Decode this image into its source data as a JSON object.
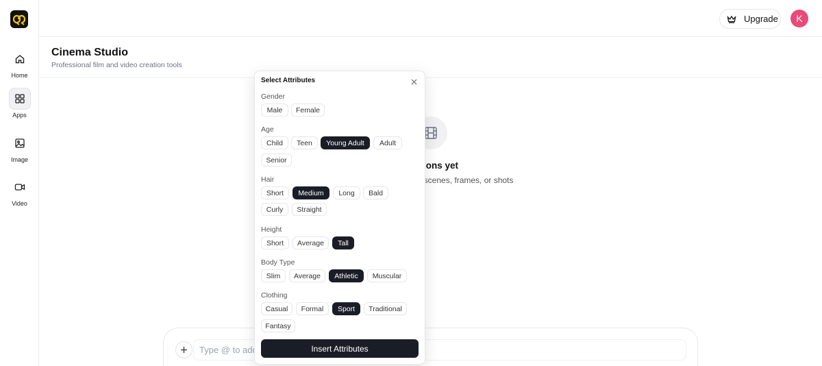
{
  "nav": {
    "items": [
      {
        "label": "Home"
      },
      {
        "label": "Apps"
      },
      {
        "label": "Image"
      },
      {
        "label": "Video"
      }
    ]
  },
  "header": {
    "upgrade_label": "Upgrade",
    "avatar_initial": "K"
  },
  "page": {
    "title": "Cinema Studio",
    "subtitle": "Professional film and video creation tools"
  },
  "empty_state": {
    "title": "ations yet",
    "description": "s, scenes, frames, or shots"
  },
  "composer": {
    "placeholder": "Type @ to add a"
  },
  "attributes_popover": {
    "title": "Select Attributes",
    "groups": [
      {
        "label": "Gender",
        "options": [
          "Male",
          "Female"
        ],
        "selected": null
      },
      {
        "label": "Age",
        "options": [
          "Child",
          "Teen",
          "Young Adult",
          "Adult",
          "Senior"
        ],
        "selected": "Young Adult"
      },
      {
        "label": "Hair",
        "options": [
          "Short",
          "Medium",
          "Long",
          "Bald",
          "Curly",
          "Straight"
        ],
        "selected": "Medium"
      },
      {
        "label": "Height",
        "options": [
          "Short",
          "Average",
          "Tall"
        ],
        "selected": "Tall"
      },
      {
        "label": "Body Type",
        "options": [
          "Slim",
          "Average",
          "Athletic",
          "Muscular"
        ],
        "selected": "Athletic"
      },
      {
        "label": "Clothing",
        "options": [
          "Casual",
          "Formal",
          "Sport",
          "Traditional",
          "Fantasy"
        ],
        "selected": "Sport"
      }
    ],
    "insert_label": "Insert Attributes"
  },
  "colors": {
    "selected_chip": "#1a1d26",
    "avatar": "#e84a7a",
    "logo_background": "#111111",
    "logo_mark": "#f5c400"
  }
}
